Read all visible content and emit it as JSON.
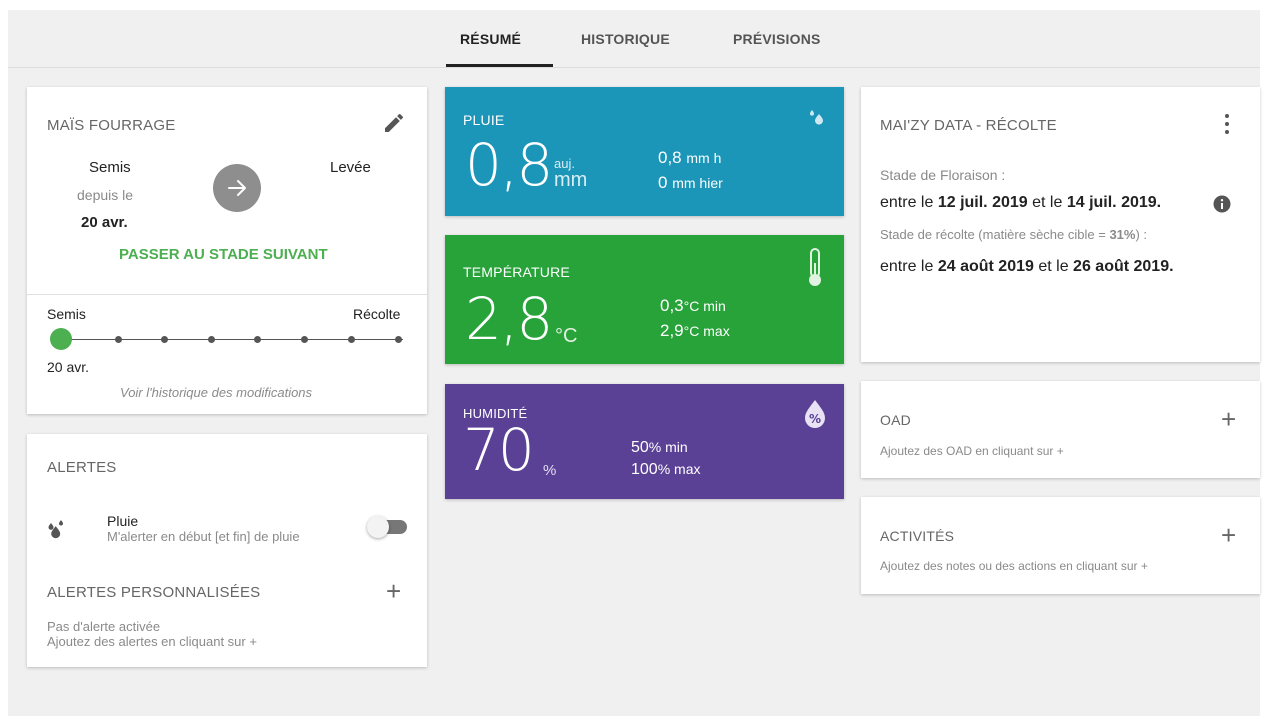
{
  "tabs": [
    {
      "label": "RÉSUMÉ"
    },
    {
      "label": "HISTORIQUE"
    },
    {
      "label": "PRÉVISIONS"
    }
  ],
  "crop": {
    "title": "MAÏS FOURRAGE",
    "from_stage": "Semis",
    "since_label": "depuis le",
    "since_date": "20 avr.",
    "to_stage": "Levée",
    "next_stage_button": "PASSER AU STADE SUIVANT",
    "timeline_start": "Semis",
    "timeline_end": "Récolte",
    "timeline_date": "20 avr.",
    "history_link": "Voir l'historique des modifications",
    "accent_color": "#4caf50"
  },
  "alerts": {
    "title": "ALERTES",
    "rain_title": "Pluie",
    "rain_desc": "M'alerter en début [et fin] de pluie",
    "custom_title": "ALERTES PERSONNALISÉES",
    "custom_none": "Pas d'alerte activée",
    "custom_hint": "Ajoutez des alertes en cliquant sur +"
  },
  "rain": {
    "label": "PLUIE",
    "value": "0,8",
    "unit_today": "auj.",
    "unit": "mm",
    "hour_value": "0,8",
    "hour_unit": "mm h",
    "yesterday_value": "0",
    "yesterday_unit": "mm hier",
    "color": "#1b95b8"
  },
  "temperature": {
    "label": "TEMPÉRATURE",
    "value": "2,8",
    "unit": "°C",
    "min_value": "0,3",
    "min_unit": "°C min",
    "max_value": "2,9",
    "max_unit": "°C max",
    "color": "#27a33a"
  },
  "humidity": {
    "label": "HUMIDITÉ",
    "value": "70",
    "unit": "%",
    "min_value": "50",
    "min_unit": "% min",
    "max_value": "100",
    "max_unit": "% max",
    "color": "#5b4196"
  },
  "maizy": {
    "title": "MAI'ZY DATA - RÉCOLTE",
    "flower_label": "Stade de Floraison :",
    "between": "entre le",
    "flower_start": "12 juil. 2019",
    "and": "et le",
    "flower_end": "14 juil. 2019.",
    "harvest_label_prefix": "Stade de récolte (matière sèche cible =",
    "harvest_target": "31%",
    "harvest_label_suffix": ") :",
    "harvest_start": "24 août 2019",
    "harvest_end": "26 août 2019."
  },
  "oad": {
    "title": "OAD",
    "hint": "Ajoutez des OAD en cliquant sur +"
  },
  "activities": {
    "title": "ACTIVITÉS",
    "hint": "Ajoutez des notes ou des actions en cliquant sur +"
  }
}
